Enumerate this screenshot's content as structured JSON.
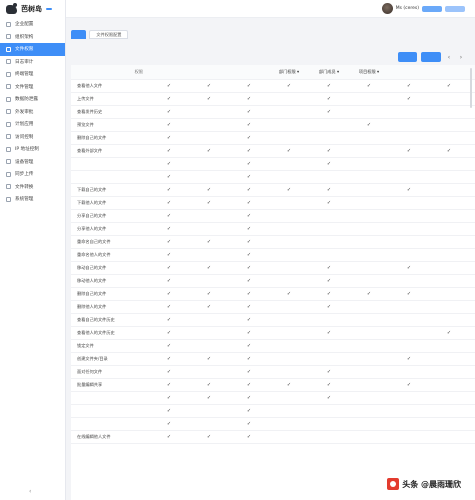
{
  "app": {
    "name": "芭树岛",
    "badge": ""
  },
  "sidebar": {
    "items": [
      {
        "label": "企业配置",
        "active": false
      },
      {
        "label": "组织架构",
        "active": false
      },
      {
        "label": "文件权限",
        "active": true
      },
      {
        "label": "日志审计",
        "active": false
      },
      {
        "label": "终端管理",
        "active": false
      },
      {
        "label": "文件管理",
        "active": false
      },
      {
        "label": "数据防泄露",
        "active": false
      },
      {
        "label": "外发审批",
        "active": false
      },
      {
        "label": "计划应用",
        "active": false
      },
      {
        "label": "访问控制",
        "active": false
      },
      {
        "label": "IP 地址控制",
        "active": false
      },
      {
        "label": "设备管理",
        "active": false
      },
      {
        "label": "同步上传",
        "active": false
      },
      {
        "label": "文件转换",
        "active": false
      },
      {
        "label": "系统管理",
        "active": false
      }
    ],
    "collapse_icon": "chevron-left-icon"
  },
  "header": {
    "user_name": "Ms (ceres)",
    "pill1": "",
    "pill2": ""
  },
  "breadcrumb": "",
  "tabs": [
    {
      "label": "",
      "active": true
    },
    {
      "label": "文件权限配置",
      "active": false
    }
  ],
  "note": "",
  "toolbar": {
    "btn1": "",
    "btn2": "",
    "prev": "‹",
    "next": "›"
  },
  "table": {
    "corner_top": "",
    "corner_label": "权限",
    "columns": [
      "",
      "",
      "",
      "部门权限 ▾",
      "部门成员 ▾",
      "项目权限 ▾",
      "",
      "",
      ""
    ],
    "check": "✓",
    "rows": [
      {
        "name": "查看他人文件",
        "blur": false,
        "c": [
          1,
          1,
          1,
          1,
          1,
          1,
          1,
          1,
          0
        ]
      },
      {
        "name": "上传文件",
        "blur": false,
        "c": [
          1,
          1,
          1,
          0,
          1,
          0,
          1,
          0,
          0
        ]
      },
      {
        "name": "查看发件历史",
        "blur": false,
        "c": [
          1,
          0,
          1,
          0,
          1,
          0,
          0,
          0,
          0
        ]
      },
      {
        "name": "预览文件",
        "blur": false,
        "c": [
          1,
          0,
          1,
          0,
          0,
          1,
          0,
          0,
          0
        ]
      },
      {
        "name": "删除自己的文件",
        "blur": false,
        "c": [
          1,
          0,
          1,
          0,
          0,
          0,
          0,
          0,
          0
        ]
      },
      {
        "name": "查看外部文件",
        "blur": false,
        "c": [
          1,
          1,
          1,
          1,
          1,
          0,
          1,
          1,
          0
        ]
      },
      {
        "name": "",
        "blur": false,
        "c": [
          1,
          0,
          1,
          0,
          1,
          0,
          0,
          0,
          0
        ]
      },
      {
        "name": "",
        "blur": false,
        "c": [
          1,
          0,
          1,
          0,
          0,
          0,
          0,
          0,
          0
        ]
      },
      {
        "name": "下载自己的文件",
        "blur": false,
        "c": [
          1,
          1,
          1,
          1,
          1,
          0,
          1,
          0,
          0
        ]
      },
      {
        "name": "下载他人的文件",
        "blur": false,
        "c": [
          1,
          1,
          1,
          0,
          1,
          0,
          0,
          0,
          0
        ]
      },
      {
        "name": "分享自己的文件",
        "blur": false,
        "c": [
          1,
          0,
          1,
          0,
          0,
          0,
          0,
          0,
          0
        ]
      },
      {
        "name": "分享他人的文件",
        "blur": false,
        "c": [
          1,
          0,
          1,
          0,
          0,
          0,
          0,
          0,
          0
        ]
      },
      {
        "name": "重命名自己的文件",
        "blur": false,
        "c": [
          1,
          1,
          1,
          0,
          0,
          0,
          0,
          0,
          0
        ]
      },
      {
        "name": "重命名他人的文件",
        "blur": false,
        "c": [
          1,
          0,
          1,
          0,
          0,
          0,
          0,
          0,
          0
        ]
      },
      {
        "name": "移动自己的文件",
        "blur": false,
        "c": [
          1,
          1,
          1,
          0,
          1,
          0,
          1,
          0,
          0
        ]
      },
      {
        "name": "移动他人的文件",
        "blur": false,
        "c": [
          1,
          0,
          1,
          0,
          1,
          0,
          0,
          0,
          0
        ]
      },
      {
        "name": "删除自己的文件",
        "blur": false,
        "c": [
          1,
          1,
          1,
          1,
          1,
          1,
          1,
          0,
          0
        ]
      },
      {
        "name": "删除他人的文件",
        "blur": false,
        "c": [
          1,
          1,
          1,
          0,
          1,
          0,
          0,
          0,
          0
        ]
      },
      {
        "name": "查看自己的文件历史",
        "blur": false,
        "c": [
          1,
          0,
          1,
          0,
          0,
          0,
          0,
          0,
          0
        ]
      },
      {
        "name": "查看他人的文件历史",
        "blur": false,
        "c": [
          1,
          0,
          1,
          0,
          1,
          0,
          0,
          1,
          0
        ]
      },
      {
        "name": "锁定文件",
        "blur": false,
        "c": [
          1,
          0,
          1,
          0,
          0,
          0,
          0,
          0,
          0
        ]
      },
      {
        "name": "创建文件夹/目录",
        "blur": false,
        "c": [
          1,
          1,
          1,
          0,
          0,
          0,
          1,
          0,
          0
        ]
      },
      {
        "name": "面对任何文件",
        "blur": false,
        "c": [
          1,
          0,
          1,
          0,
          1,
          0,
          0,
          0,
          0
        ]
      },
      {
        "name": "批量编辑共享",
        "blur": false,
        "c": [
          1,
          1,
          1,
          1,
          1,
          0,
          1,
          0,
          0
        ]
      },
      {
        "name": "",
        "blur": true,
        "c": [
          1,
          1,
          1,
          0,
          1,
          0,
          0,
          0,
          0
        ]
      },
      {
        "name": "",
        "blur": true,
        "c": [
          1,
          0,
          1,
          0,
          0,
          0,
          0,
          0,
          0
        ]
      },
      {
        "name": "",
        "blur": true,
        "c": [
          1,
          0,
          1,
          0,
          0,
          0,
          0,
          0,
          0
        ]
      },
      {
        "name": "在线编辑他人文件",
        "blur": false,
        "c": [
          1,
          1,
          1,
          0,
          0,
          0,
          0,
          0,
          0
        ]
      }
    ]
  },
  "watermark": {
    "text": "头条 @晨雨珊欣"
  }
}
